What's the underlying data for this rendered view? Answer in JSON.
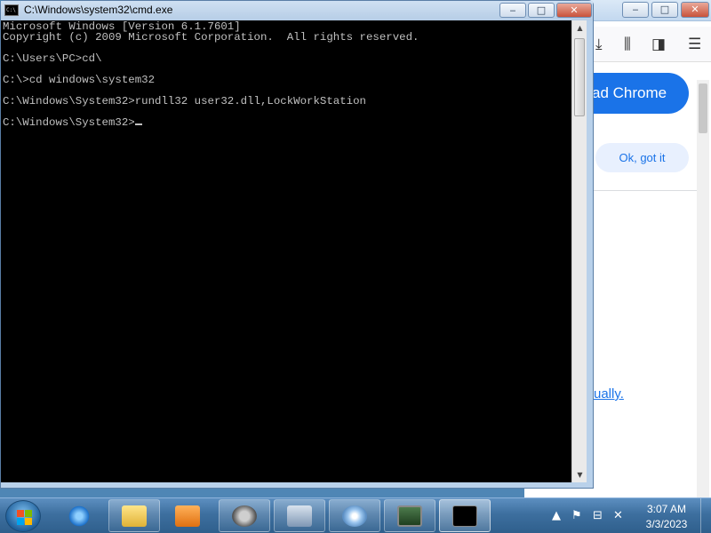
{
  "cmd_window": {
    "title": "C:\\Windows\\system32\\cmd.exe",
    "icon_text": "C:\\",
    "controls": {
      "minimize": "‒",
      "maximize": "□",
      "close": "✕"
    },
    "console_lines": [
      "Microsoft Windows [Version 6.1.7601]",
      "Copyright (c) 2009 Microsoft Corporation.  All rights reserved.",
      "",
      "C:\\Users\\PC>cd\\",
      "",
      "C:\\>cd windows\\system32",
      "",
      "C:\\Windows\\System32>rundll32 user32.dll,LockWorkStation",
      "",
      "C:\\Windows\\System32>"
    ]
  },
  "browser_window": {
    "controls": {
      "minimize": "‒",
      "maximize": "□",
      "close": "✕"
    },
    "toolbar_icons": [
      "download-icon",
      "library-icon",
      "sidebar-icon",
      "menu-icon"
    ],
    "download_button": "ad Chrome",
    "ok_button": "Ok, got it",
    "link_text": "ually."
  },
  "taskbar": {
    "apps": [
      "internet-explorer",
      "file-explorer",
      "media-player",
      "raccoon-app",
      "tools-app",
      "disc-app",
      "monitor-app",
      "cmd"
    ],
    "clock": {
      "time": "3:07 AM",
      "date": "3/3/2023"
    },
    "tray_icons": [
      "show-hidden-icons",
      "action-center-flag",
      "network-icon",
      "volume-muted-icon"
    ]
  },
  "colors": {
    "console_bg": "#000000",
    "console_fg": "#c0c0c0",
    "accent": "#1a73e8"
  }
}
